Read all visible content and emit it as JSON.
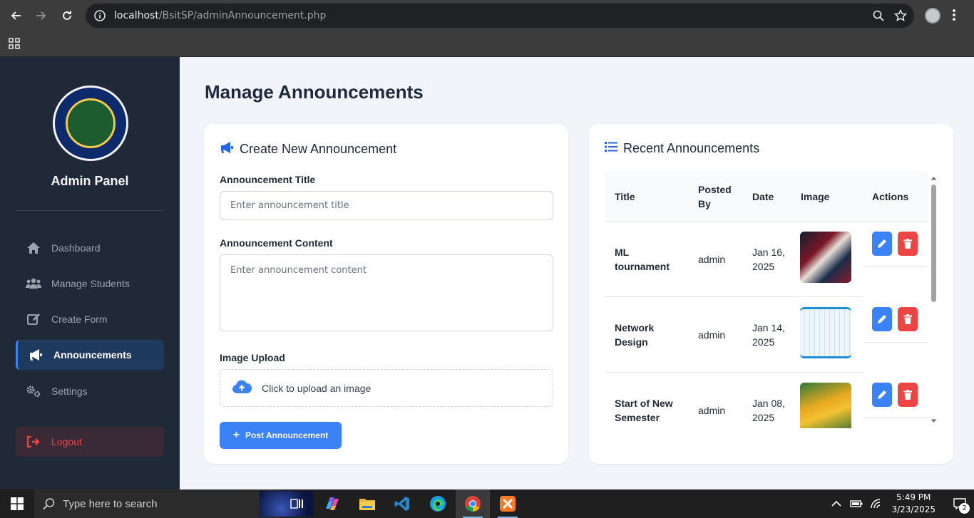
{
  "browser": {
    "url_host": "localhost",
    "url_path": "/BsitSP/adminAnnouncement.php"
  },
  "sidebar": {
    "title": "Admin Panel",
    "items": [
      {
        "label": "Dashboard",
        "icon": "home-icon"
      },
      {
        "label": "Manage Students",
        "icon": "users-icon"
      },
      {
        "label": "Create Form",
        "icon": "edit-icon"
      },
      {
        "label": "Announcements",
        "icon": "megaphone-icon",
        "active": true
      },
      {
        "label": "Settings",
        "icon": "gears-icon"
      }
    ],
    "logout_label": "Logout"
  },
  "main": {
    "page_title": "Manage Announcements",
    "create": {
      "heading": "Create New Announcement",
      "title_label": "Announcement Title",
      "title_placeholder": "Enter announcement title",
      "content_label": "Announcement Content",
      "content_placeholder": "Enter announcement content",
      "image_label": "Image Upload",
      "upload_text": "Click to upload an image",
      "post_button": "Post Announcement"
    },
    "recent": {
      "heading": "Recent Announcements",
      "columns": [
        "Title",
        "Posted By",
        "Date",
        "Image",
        "Actions"
      ],
      "rows": [
        {
          "title": "ML tournament",
          "posted_by": "admin",
          "date": "Jan 16, 2025",
          "thumb_color": "#2b1a2e"
        },
        {
          "title": "Network Design",
          "posted_by": "admin",
          "date": "Jan 14, 2025",
          "thumb_color": "#e8f1f6"
        },
        {
          "title": "Start of New Semester",
          "posted_by": "admin",
          "date": "Jan 08, 2025",
          "thumb_color": "#e6a820"
        }
      ]
    }
  },
  "taskbar": {
    "search_placeholder": "Type here to search",
    "time": "5:49 PM",
    "date": "3/23/2025",
    "notification_count": "2"
  },
  "colors": {
    "accent": "#3b82f6",
    "danger": "#ef4444",
    "sidebar_bg": "#1f2937"
  }
}
